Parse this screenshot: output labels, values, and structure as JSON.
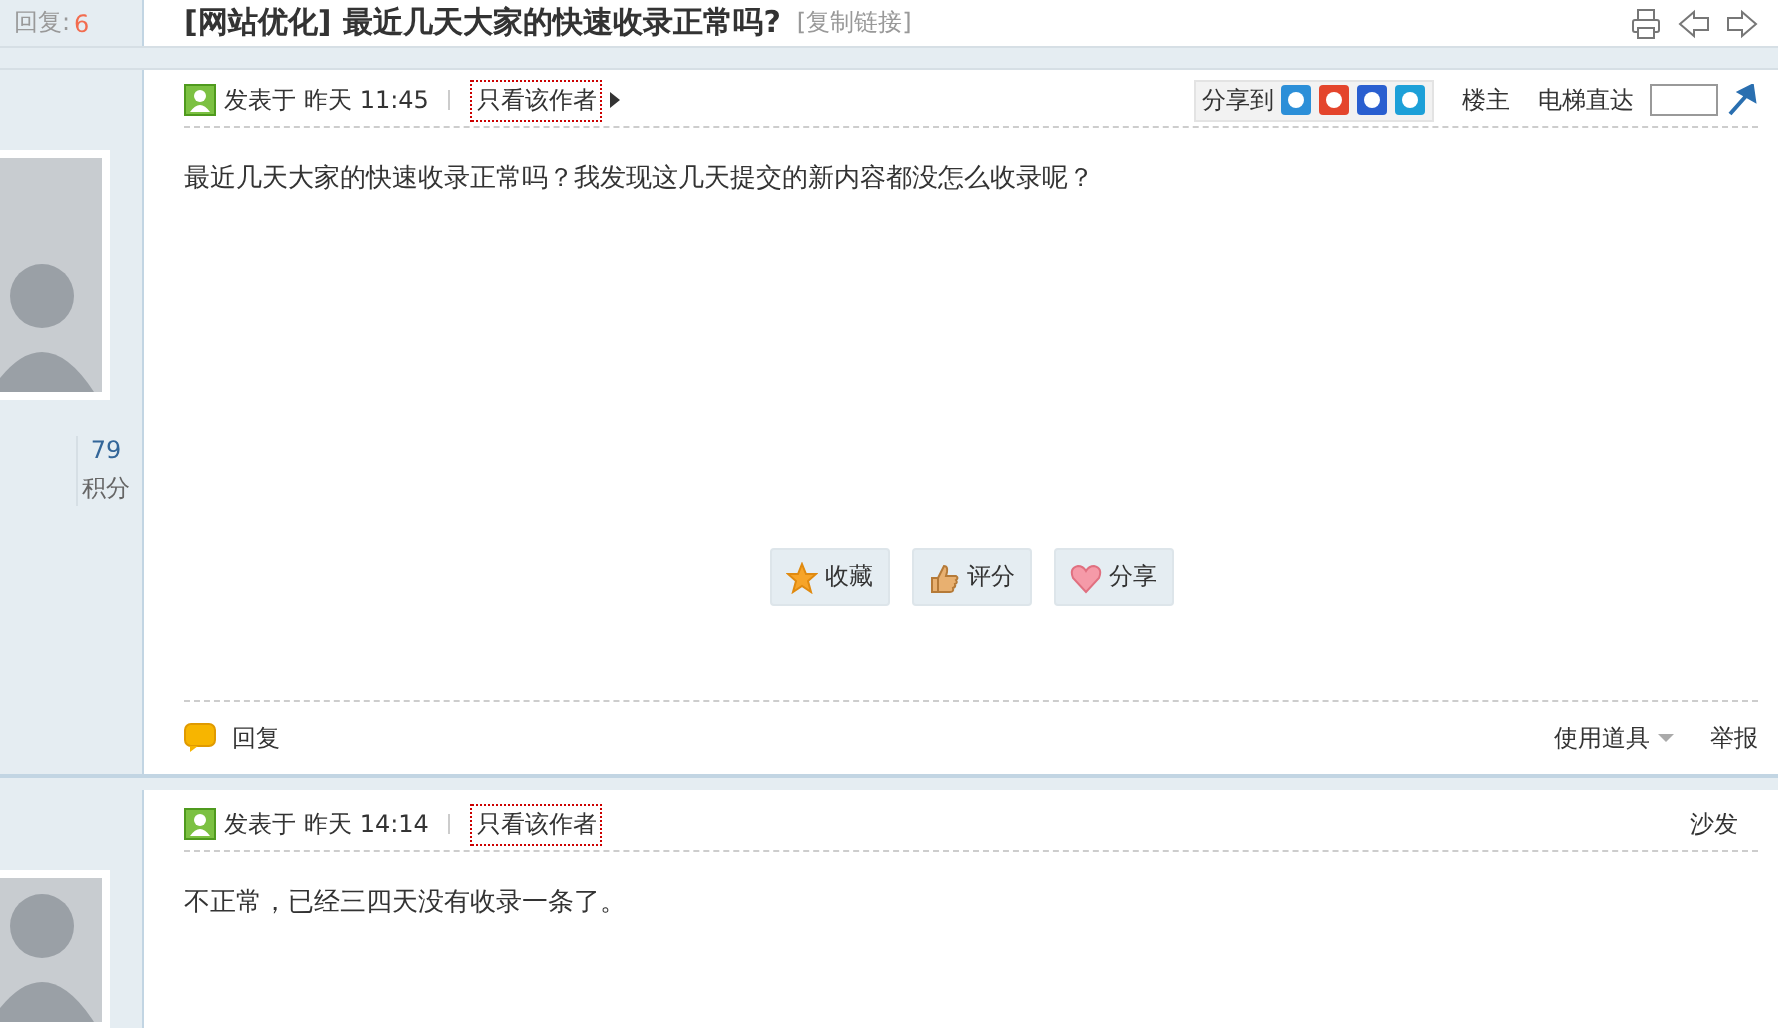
{
  "thread": {
    "reply_label": "回复:",
    "reply_count": "6",
    "category": "[网站优化]",
    "title": "最近几天大家的快速收录正常吗?",
    "copy_link": "[复制链接]"
  },
  "posts": [
    {
      "points": "79",
      "points_label": "积分",
      "posted": "发表于",
      "time": "昨天 11:45",
      "only_author": "只看该作者",
      "share_label": "分享到",
      "floor": "楼主",
      "jump_label": "电梯直达",
      "body": "最近几天大家的快速收录正常吗？我发现这几天提交的新内容都没怎么收录呢？",
      "actions": [
        {
          "kind": "favorite",
          "label": "收藏"
        },
        {
          "kind": "rate",
          "label": "评分"
        },
        {
          "kind": "share",
          "label": "分享"
        }
      ],
      "reply": "回复",
      "tools": "使用道具",
      "report": "举报"
    },
    {
      "posted": "发表于",
      "time": "昨天 14:14",
      "only_author": "只看该作者",
      "floor": "沙发",
      "body": "不正常，已经三四天没有收录一条了。"
    }
  ]
}
